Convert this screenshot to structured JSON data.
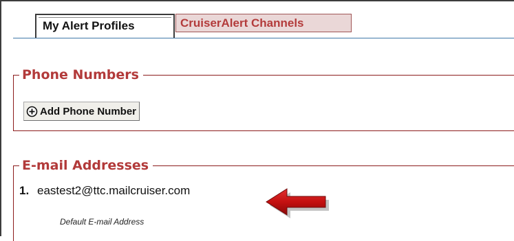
{
  "tabs": [
    {
      "label": "My Alert Profiles",
      "active": true
    },
    {
      "label": "CruiserAlert Channels",
      "active": false
    }
  ],
  "phone_section": {
    "legend": "Phone Numbers",
    "add_button_label": "Add Phone Number",
    "add_icon": "plus-circle-icon"
  },
  "email_section": {
    "legend": "E-mail Addresses",
    "items": [
      {
        "index": "1.",
        "address": "eastest2@ttc.mailcruiser.com",
        "note": "Default E-mail Address"
      }
    ]
  },
  "annotation": {
    "icon": "red-arrow-left",
    "color": "#c41010"
  },
  "colors": {
    "accent": "#b23a3a",
    "border": "#8b1a1a",
    "tab_inactive_bg": "#ead7d7"
  }
}
